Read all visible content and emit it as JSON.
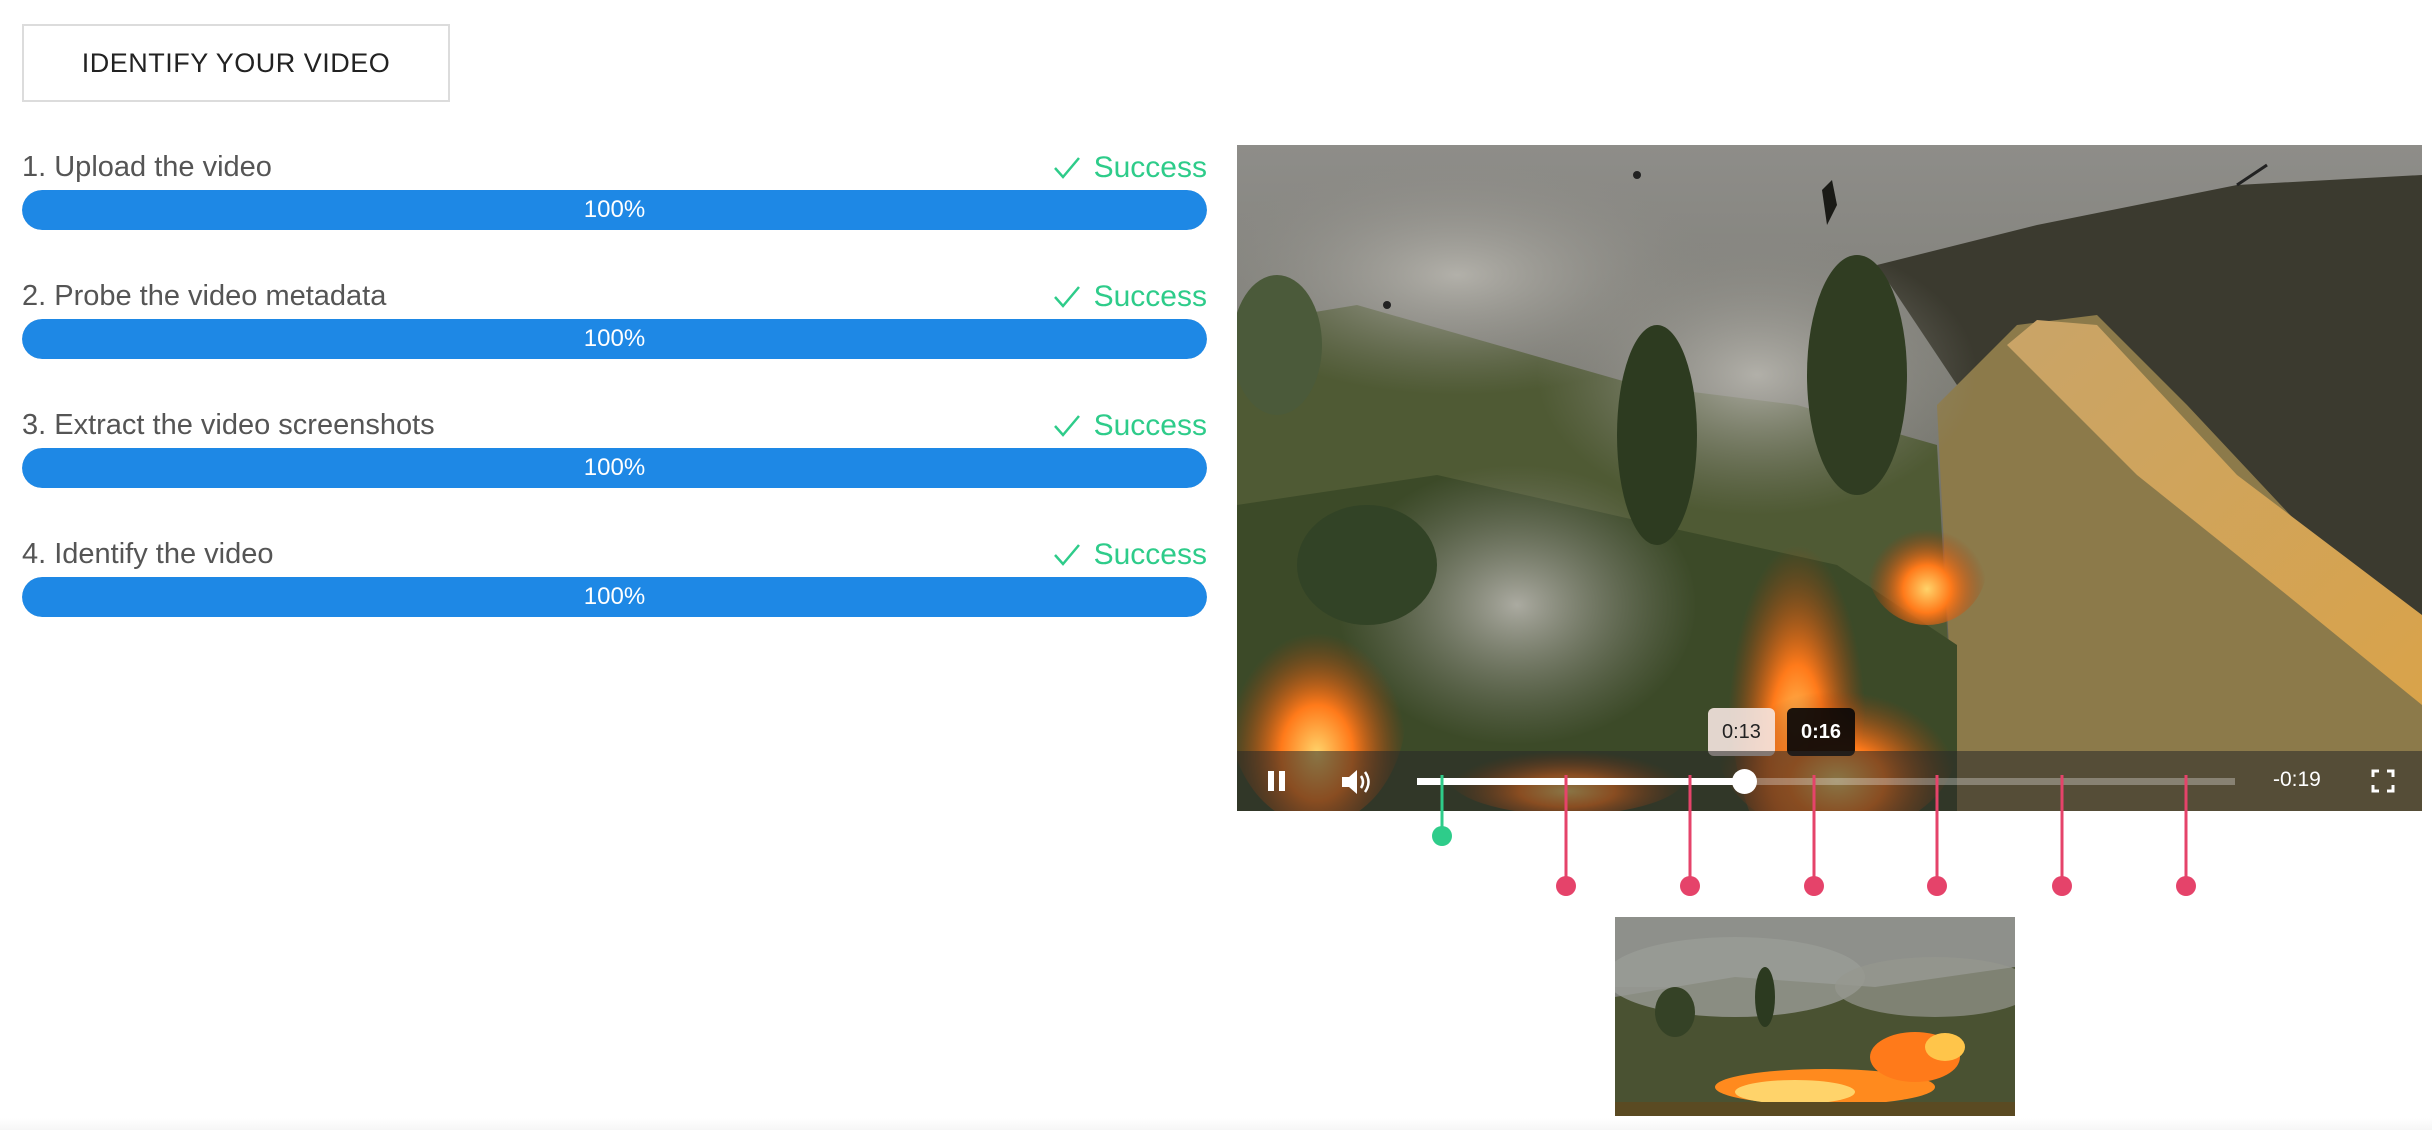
{
  "header": {
    "identify_button_label": "IDENTIFY YOUR VIDEO"
  },
  "steps": [
    {
      "label": "1. Upload the video",
      "status": "Success",
      "progress_percent": 100,
      "progress_text": "100%"
    },
    {
      "label": "2. Probe the video metadata",
      "status": "Success",
      "progress_percent": 100,
      "progress_text": "100%"
    },
    {
      "label": "3. Extract the video screenshots",
      "status": "Success",
      "progress_percent": 100,
      "progress_text": "100%"
    },
    {
      "label": "4. Identify the video",
      "status": "Success",
      "progress_percent": 100,
      "progress_text": "100%"
    }
  ],
  "player": {
    "time_remaining": "-0:19",
    "playback_fraction": 0.4,
    "hover_tooltip_light": "0:13",
    "hover_tooltip_dark": "0:16",
    "playing": true,
    "icons": {
      "pause": "pause-icon",
      "volume": "volume-icon",
      "fullscreen": "fullscreen-icon"
    }
  },
  "markers": {
    "current_color": "#2ecc8a",
    "screenshot_color": "#e5436a",
    "screenshot_count": 6
  },
  "colors": {
    "progress": "#1e88e5",
    "success": "#2ecc8a"
  }
}
